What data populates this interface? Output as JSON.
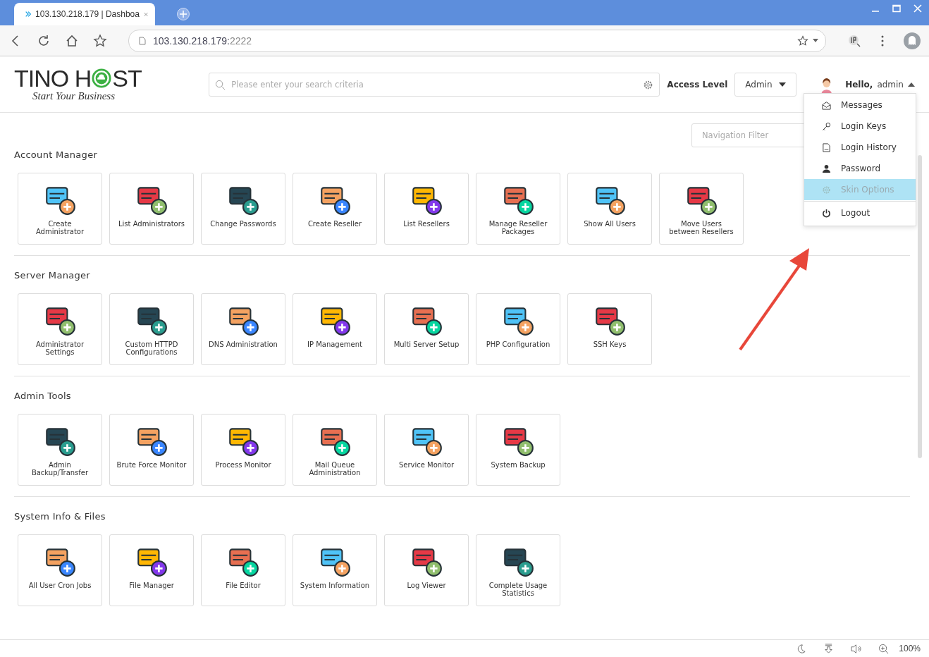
{
  "browser": {
    "tab_title": "103.130.218.179 | Dashboa",
    "address_host": "103.130.218.179:",
    "address_port": "2222",
    "zoom": "100%"
  },
  "header": {
    "logo_left": "TINO H",
    "logo_right": "ST",
    "tagline": "Start Your Business",
    "search": {
      "placeholder": "Please enter your search criteria"
    },
    "access_label": "Access Level",
    "access_value": "Admin",
    "greeting": "Hello,",
    "user": "admin"
  },
  "user_menu": [
    {
      "label": "Messages",
      "kind": "envelope",
      "selected": false
    },
    {
      "label": "Login Keys",
      "kind": "key",
      "selected": false
    },
    {
      "label": "Login History",
      "kind": "log",
      "selected": false
    },
    {
      "label": "Password",
      "kind": "person",
      "selected": false
    },
    {
      "label": "Skin Options",
      "kind": "gear",
      "selected": true
    },
    {
      "label": "Logout",
      "kind": "power",
      "selected": false
    }
  ],
  "nav_filter": {
    "placeholder": "Navigation Filter"
  },
  "sections": [
    {
      "title": "Account Manager",
      "items": [
        "Create Administrator",
        "List Administrators",
        "Change Passwords",
        "Create Reseller",
        "List Resellers",
        "Manage Reseller Packages",
        "Show All Users",
        "Move Users between Resellers"
      ]
    },
    {
      "title": "Server Manager",
      "items": [
        "Administrator Settings",
        "Custom HTTPD Configurations",
        "DNS Administration",
        "IP Management",
        "Multi Server Setup",
        "PHP Configuration",
        "SSH Keys"
      ]
    },
    {
      "title": "Admin Tools",
      "items": [
        "Admin Backup/Transfer",
        "Brute Force Monitor",
        "Process Monitor",
        "Mail Queue Administration",
        "Service Monitor",
        "System Backup"
      ]
    },
    {
      "title": "System Info & Files",
      "items": [
        "All User Cron Jobs",
        "File Manager",
        "File Editor",
        "System Information",
        "Log Viewer",
        "Complete Usage Statistics"
      ]
    }
  ]
}
